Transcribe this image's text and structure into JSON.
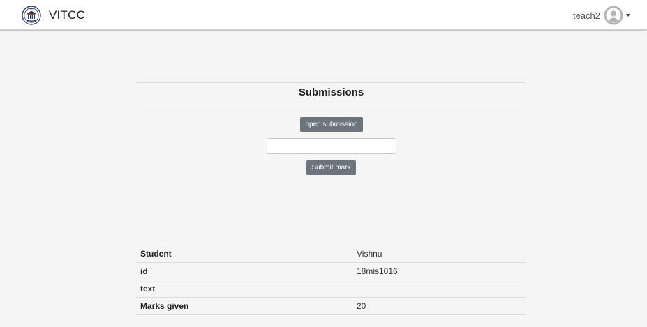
{
  "navbar": {
    "brand": "VITCC",
    "username": "teach2",
    "logo_icon": "university-logo-icon",
    "avatar_icon": "user-avatar-icon",
    "caret_icon": "caret-down-icon"
  },
  "main": {
    "heading": "Submissions",
    "open_button": "open submission",
    "mark_input_value": "",
    "submit_button": "Submit mark"
  },
  "details": {
    "rows": [
      {
        "key": "Student",
        "value": "Vishnu"
      },
      {
        "key": "id",
        "value": "18mis1016"
      },
      {
        "key": "text",
        "value": ""
      },
      {
        "key": "Marks given",
        "value": "20"
      }
    ]
  },
  "colors": {
    "button_bg": "#6c757d",
    "page_bg": "#f5f5f5",
    "navbar_bg": "#ffffff"
  }
}
